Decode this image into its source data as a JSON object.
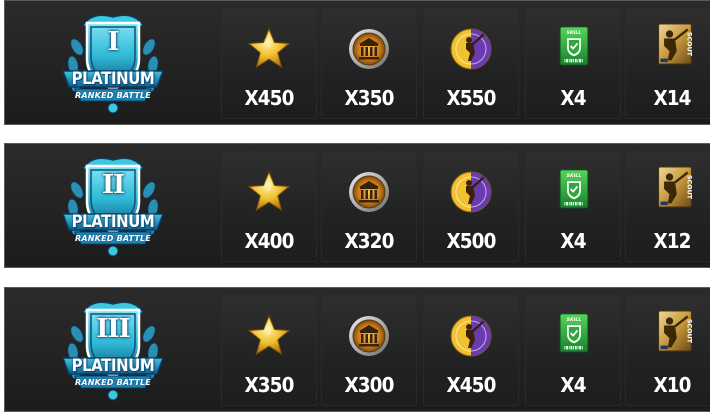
{
  "colors": {
    "badge_teal": "#2fb9d6",
    "badge_dark": "#0f4f7a",
    "star_gold": "#f2c12e",
    "skill_green": "#2fa83a",
    "scout_gold": "#c89a3c"
  },
  "reward_icons": [
    "star-icon",
    "bank-coin-icon",
    "batter-coin-icon",
    "skill-ticket-icon",
    "scout-card-icon"
  ],
  "tiers": [
    {
      "roman": "I",
      "title": "PLATINUM",
      "subtitle": "RANKED BATTLE",
      "rewards": [
        "X450",
        "X350",
        "X550",
        "X4",
        "X14"
      ]
    },
    {
      "roman": "II",
      "title": "PLATINUM",
      "subtitle": "RANKED BATTLE",
      "rewards": [
        "X400",
        "X320",
        "X500",
        "X4",
        "X12"
      ]
    },
    {
      "roman": "III",
      "title": "PLATINUM",
      "subtitle": "RANKED BATTLE",
      "rewards": [
        "X350",
        "X300",
        "X450",
        "X4",
        "X10"
      ]
    }
  ],
  "skill_label": "SKILL",
  "scout_label": "SCOUT"
}
